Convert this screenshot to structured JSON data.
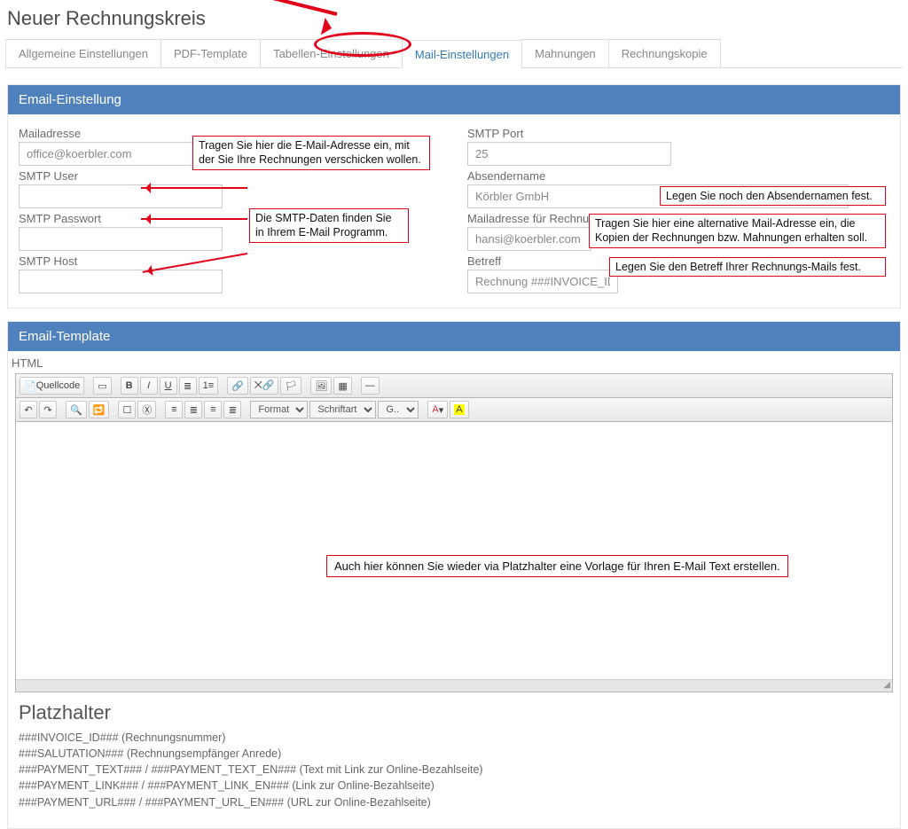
{
  "page": {
    "title": "Neuer Rechnungskreis"
  },
  "tabs": {
    "t0": "Allgemeine Einstellungen",
    "t1": "PDF-Template",
    "t2": "Tabellen-Einstellungen",
    "t3": "Mail-Einstellungen",
    "t4": "Mahnungen",
    "t5": "Rechnungskopie"
  },
  "panel1": {
    "header": "Email-Einstellung",
    "left": {
      "mailadresse_label": "Mailadresse",
      "mailadresse_value": "office@koerbler.com",
      "smtp_user_label": "SMTP User",
      "smtp_user_value": "",
      "smtp_pass_label": "SMTP Passwort",
      "smtp_pass_value": "",
      "smtp_host_label": "SMTP Host",
      "smtp_host_value": ""
    },
    "right": {
      "smtp_port_label": "SMTP Port",
      "smtp_port_value": "25",
      "sender_label": "Absendername",
      "sender_value": "Körbler GmbH",
      "copy_label": "Mailadresse für Rechnungs/Mahnungs-Kopien",
      "copy_value": "hansi@koerbler.com",
      "subject_label": "Betreff",
      "subject_value": "Rechnung ###INVOICE_ID###"
    }
  },
  "hints": {
    "h1": "Tragen Sie hier die E-Mail-Adresse ein, mit der Sie Ihre Rechnungen verschicken wollen.",
    "h2": "Die SMTP-Daten finden Sie in Ihrem E-Mail Programm.",
    "h3": "Legen Sie noch den Absendernamen fest.",
    "h4": "Tragen Sie hier eine alternative Mail-Adresse ein, die Kopien der Rechnungen bzw. Mahnungen erhalten soll.",
    "h5": "Legen Sie den Betreff Ihrer Rechnungs-Mails fest.",
    "h6": "Auch hier können Sie wieder via Platzhalter eine Vorlage für Ihren E-Mail Text erstellen."
  },
  "panel2": {
    "header": "Email-Template",
    "html_label": "HTML",
    "source_btn": "Quellcode",
    "format_sel": "Format",
    "font_sel": "Schriftart",
    "size_sel": "G..."
  },
  "placeholders": {
    "title": "Platzhalter",
    "p1": "###INVOICE_ID### (Rechnungsnummer)",
    "p2": "###SALUTATION### (Rechnungsempfänger Anrede)",
    "p3": "###PAYMENT_TEXT### / ###PAYMENT_TEXT_EN### (Text mit Link zur Online-Bezahlseite)",
    "p4": "###PAYMENT_LINK### / ###PAYMENT_LINK_EN### (Link zur Online-Bezahlseite)",
    "p5": "###PAYMENT_URL### / ###PAYMENT_URL_EN### (URL zur Online-Bezahlseite)"
  }
}
